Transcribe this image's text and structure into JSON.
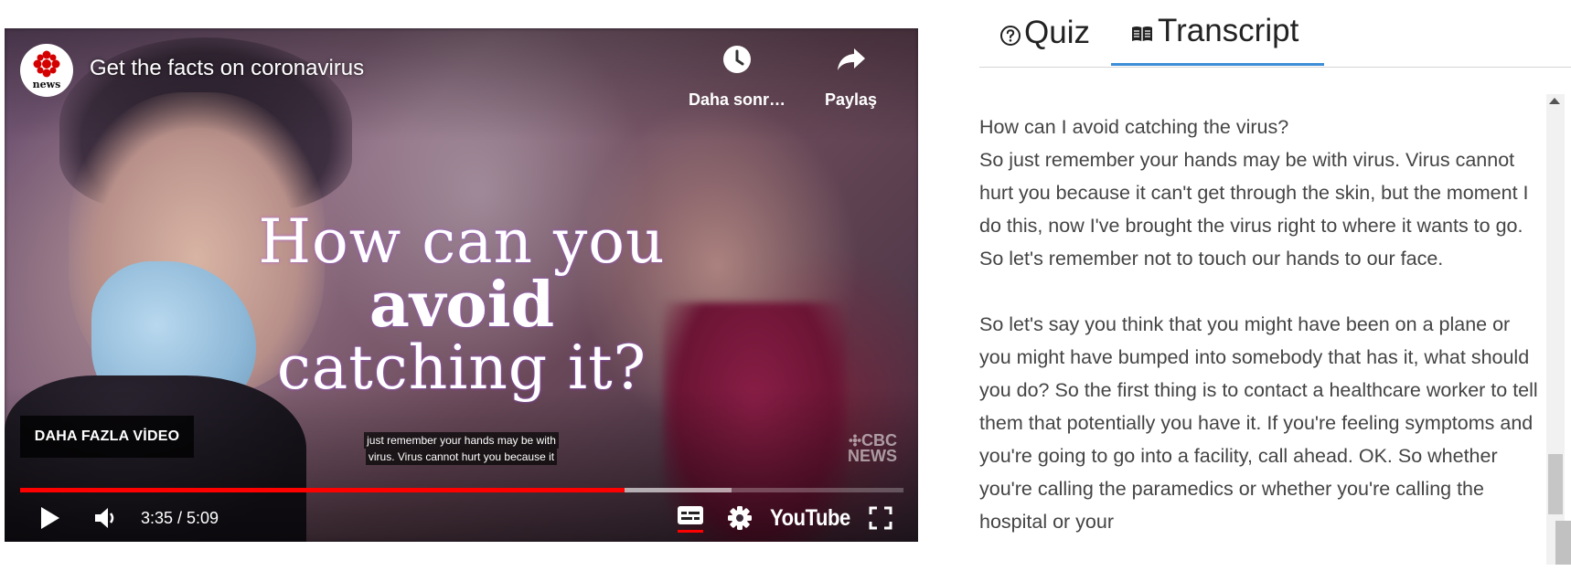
{
  "player": {
    "title": "Get the facts on coronavirus",
    "channel_logo_text": "news",
    "headline": {
      "line1": "How can you",
      "line2": "avoid",
      "line3": "catching it?"
    },
    "actions": {
      "watch_later": "Daha sonr…",
      "share": "Paylaş"
    },
    "more_videos_label": "DAHA FAZLA VİDEO",
    "captions": {
      "line1": "just remember your hands may be with",
      "line2": "virus. Virus cannot hurt you because it"
    },
    "watermark": {
      "line1": "CBC",
      "line2": "NEWS"
    },
    "time_display": "3:35 / 5:09",
    "progress": {
      "played_fraction": 0.684,
      "loaded_fraction": 0.805
    },
    "youtube_logo": "YouTube",
    "icons": [
      "play-icon",
      "volume-icon",
      "captions-icon",
      "settings-icon",
      "fullscreen-icon",
      "clock-icon",
      "share-icon"
    ],
    "colors": {
      "progress_played": "#ff0000",
      "captions_underline": "#ff0000"
    }
  },
  "panel": {
    "tabs": [
      {
        "label": "Quiz",
        "icon": "question-circle-icon",
        "active": false
      },
      {
        "label": "Transcript",
        "icon": "book-icon",
        "active": true
      }
    ],
    "accent_color": "#3d8ed6",
    "transcript": {
      "paragraph1": "How can I avoid catching the virus?\nSo just remember your hands may be with virus. Virus cannot hurt you because it can't get through the skin, but the moment I do this, now I've brought the virus right to where it wants to go. So let's remember not to touch our hands to our face.",
      "paragraph2": "So let's say you think that you might have been on a plane or you might have bumped into somebody that has it, what should you do? So the first thing is to contact a healthcare worker to tell them that potentially you have it. If you're feeling symptoms and you're going to go into a facility, call ahead. OK. So whether you're calling the paramedics or whether you're calling the hospital or your"
    }
  }
}
